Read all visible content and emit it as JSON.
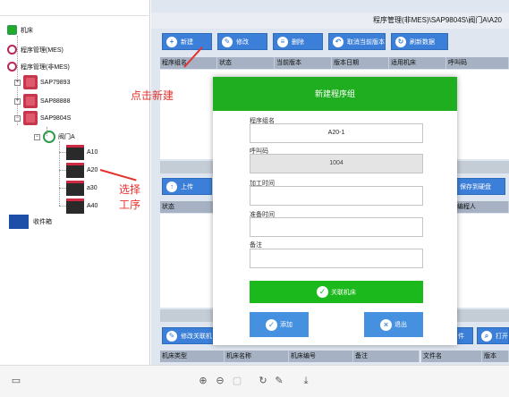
{
  "tree": {
    "items": [
      {
        "label": "机床"
      },
      {
        "label": "程序管理(MES)"
      },
      {
        "label": "程序管理(非MES)"
      },
      {
        "label": "SAP79893"
      },
      {
        "label": "SAP88888"
      },
      {
        "label": "SAP9804S"
      },
      {
        "label": "阀门A"
      },
      {
        "label": "A10"
      },
      {
        "label": "A20"
      },
      {
        "label": "a30"
      },
      {
        "label": "A40"
      },
      {
        "label": "收件箱"
      }
    ]
  },
  "annotations": {
    "click_new": "点击新建",
    "select_process": "选择工序"
  },
  "main": {
    "breadcrumb": "程序管理(非MES)\\SAP9804S\\阀门A\\A20",
    "toolbar": {
      "new": "新建",
      "edit": "修改",
      "delete": "删除",
      "cancel_version": "取消当前版本",
      "refresh": "刷新数据"
    },
    "table1_headers": [
      "程序组名",
      "状态",
      "当前版本",
      "版本日期",
      "适用机床",
      "呼叫码"
    ],
    "upload": "上传",
    "save_disk": "保存到硬盘",
    "table2_headers": [
      "状态",
      "编程人"
    ],
    "edit_assoc": "修改关联机",
    "file_btn": "件",
    "open_btn": "打开",
    "table3_headers": [
      "机床类型",
      "机床名称",
      "机床编号",
      "备注"
    ],
    "table4_headers": [
      "文件名",
      "版本"
    ]
  },
  "modal": {
    "title": "新建程序组",
    "fields": {
      "name_label": "程序组名",
      "name_value": "A20-1",
      "call_label": "呼叫码",
      "call_value": "1004",
      "machining_label": "加工时间",
      "prep_label": "准备时间",
      "note_label": "备注"
    },
    "link_machine": "关联机床",
    "add": "添加",
    "exit": "退出"
  },
  "colors": {
    "accent_blue": "#3c7fd8",
    "modal_green": "#1fae1f",
    "annotation_red": "#e5322d"
  }
}
